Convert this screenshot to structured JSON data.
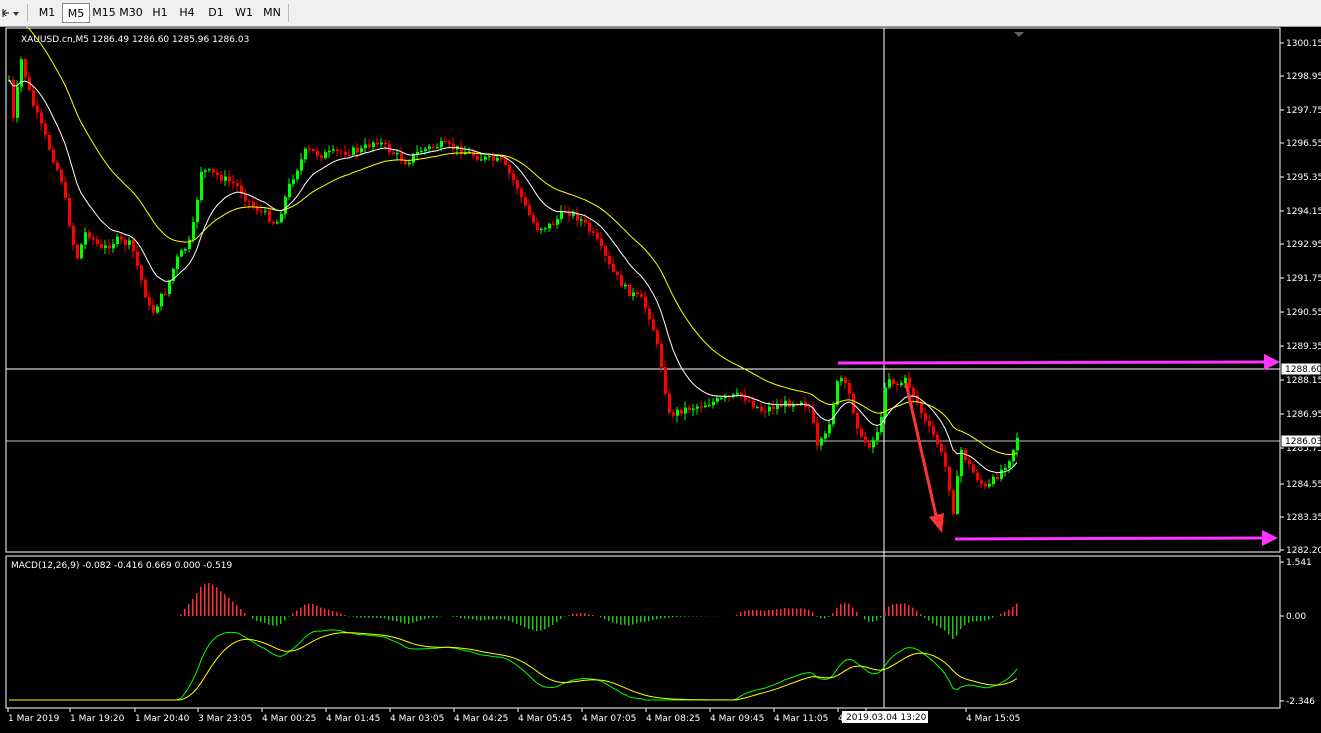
{
  "toolbar": {
    "menu_icon": "cursor-dropdown-icon",
    "timeframes": [
      "M1",
      "M5",
      "M15",
      "M30",
      "H1",
      "H4",
      "D1",
      "W1",
      "MN"
    ],
    "active_timeframe": "M5"
  },
  "main_chart": {
    "header": "XAUUSD.cn,M5  1286.49 1286.60 1285.96 1286.03",
    "price_ticks": [
      "1300.15",
      "1298.95",
      "1297.75",
      "1296.55",
      "1295.35",
      "1294.15",
      "1292.95",
      "1291.75",
      "1290.55",
      "1289.35",
      "1288.15",
      "1286.95",
      "1285.75",
      "1284.55",
      "1283.35",
      "1282.20"
    ],
    "level_top_label": "1288.60",
    "level_current_label": "1286.03",
    "colors": {
      "bull": "#00ff00",
      "bear": "#ff0000",
      "ma_fast": "#ffffff",
      "ma_slow": "#ffff00",
      "arrow_magenta": "#ff33ff",
      "arrow_red": "#ff3333"
    }
  },
  "macd": {
    "header": "MACD(12,26,9) -0.082 -0.416 0.669 0.000 -0.519",
    "ticks": [
      "1.541",
      "0.00",
      "-2.346"
    ]
  },
  "time_axis": {
    "labels": [
      "1 Mar 2019",
      "1 Mar 19:20",
      "1 Mar 20:40",
      "3 Mar 23:05",
      "4 Mar 00:25",
      "4 Mar 01:45",
      "4 Mar 03:05",
      "4 Mar 04:25",
      "4 Mar 05:45",
      "4 Mar 07:05",
      "4 Mar 08:25",
      "4 Mar 09:45",
      "4 Mar 11:05",
      "4",
      "4 Mar 13:45",
      "4 Mar 15:05"
    ],
    "crosshair_label": "2019.03.04 13:20"
  },
  "chart_data": {
    "type": "candlestick",
    "symbol": "XAUUSD.cn",
    "timeframe": "M5",
    "last_bar": {
      "open": 1286.49,
      "high": 1286.6,
      "low": 1285.96,
      "close": 1286.03
    },
    "ylim": [
      1282.2,
      1300.15
    ],
    "macd": {
      "fast": 12,
      "slow": 26,
      "signal": 9,
      "values": [
        -0.082,
        -0.416,
        0.669,
        0.0,
        -0.519
      ],
      "ylim": [
        -2.346,
        1.541
      ]
    }
  }
}
